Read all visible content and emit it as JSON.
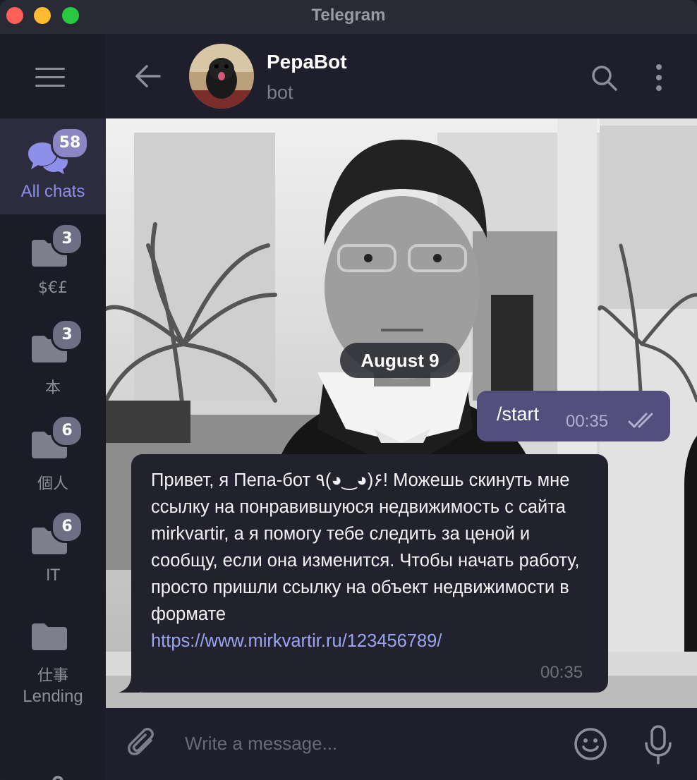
{
  "window": {
    "title": "Telegram"
  },
  "sidebar": {
    "menu_icon": "hamburger-menu-icon",
    "folders": [
      {
        "label": "All chats",
        "badge": "58",
        "icon": "chats-icon",
        "active": true
      },
      {
        "label": "$€£",
        "badge": "3",
        "icon": "folder-icon"
      },
      {
        "label": "本",
        "badge": "3",
        "icon": "folder-icon"
      },
      {
        "label": "個人",
        "badge": "6",
        "icon": "folder-icon"
      },
      {
        "label": "IT",
        "badge": "6",
        "icon": "folder-icon"
      },
      {
        "label_line1": "仕事",
        "label_line2": "Lending",
        "icon": "folder-icon"
      }
    ],
    "settings_icon": "sliders-icon"
  },
  "header": {
    "back_icon": "arrow-left-icon",
    "chat_name": "PepaBot",
    "status": "bot",
    "search_icon": "search-icon",
    "more_icon": "vertical-dots-icon"
  },
  "chat": {
    "date_separator": "August 9",
    "messages": [
      {
        "direction": "outgoing",
        "text": "/start",
        "time": "00:35",
        "status": "read"
      },
      {
        "direction": "incoming",
        "text": "Привет, я Пепа-бот ٩(◕‿◕)۶! Можешь скинуть мне ссылку на понравившуюся недвижимость с сайта mirkvartir, а я помогу тебе следить за ценой и сообщу, если она изменится. Чтобы начать работу, просто пришли ссылку на объект недвижимости в формате",
        "link": "https://www.mirkvartir.ru/123456789/",
        "time": "00:35"
      }
    ]
  },
  "composer": {
    "placeholder": "Write a message...",
    "attach_icon": "paperclip-icon",
    "emoji_icon": "smiley-icon",
    "mic_icon": "microphone-icon"
  },
  "colors": {
    "accent": "#8e8fe8",
    "outgoing_bubble": "#524f7c",
    "incoming_bubble": "#22222e",
    "link": "#9aa4ee",
    "unread_badge_active": "#8c87c4",
    "unread_badge": "#6e6e84"
  }
}
